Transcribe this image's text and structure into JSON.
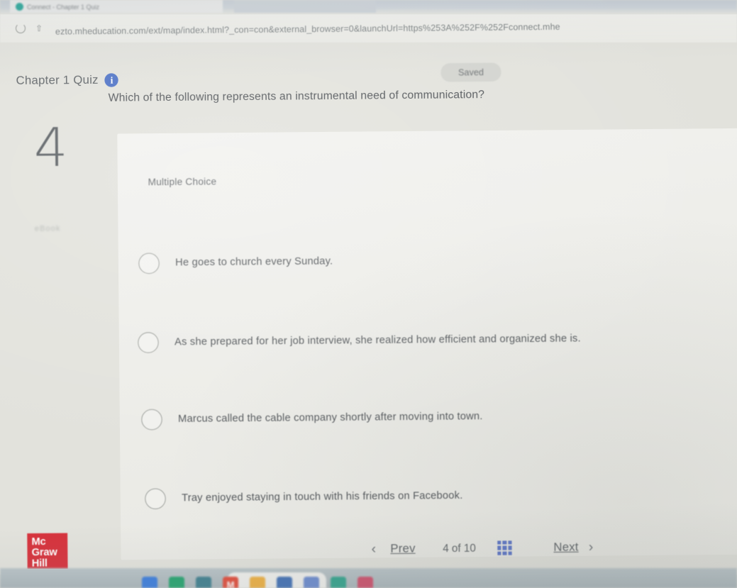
{
  "browser": {
    "tab_title": "Connect - Chapter 1 Quiz",
    "url": "ezto.mheducation.com/ext/map/index.html?_con=con&external_browser=0&launchUrl=https%253A%252F%252Fconnect.mhe",
    "reload_icon": "reload-icon",
    "share_icon": "share-icon"
  },
  "quiz": {
    "title": "Chapter 1 Quiz",
    "info_icon_glyph": "i",
    "saved_label": "Saved",
    "question_number": "4",
    "question_sublabel": "eBook",
    "question_text": "Which of the following represents an instrumental need of communication?",
    "question_type_label": "Multiple Choice",
    "choices": [
      {
        "label": "He goes to church every Sunday.",
        "selected": false
      },
      {
        "label": "As she prepared for her job interview, she realized how efficient and organized she is.",
        "selected": false
      },
      {
        "label": "Marcus called the cable company shortly after moving into town.",
        "selected": false
      },
      {
        "label": "Tray enjoyed staying in touch with his friends on Facebook.",
        "selected": false
      }
    ]
  },
  "footer": {
    "logo_line1": "Mc",
    "logo_line2": "Graw",
    "logo_line3": "Hill",
    "logo_color": "#d6323c",
    "prev_chevron": "‹",
    "prev_label": "Prev",
    "page_counter": "4 of 10",
    "grid_icon": "grid-view-icon",
    "next_label": "Next",
    "next_chevron": "›"
  },
  "taskbar": {
    "icons": [
      {
        "name": "chrome-icon",
        "glyph": "",
        "color": "#3b7ddd"
      },
      {
        "name": "drive-icon",
        "glyph": "",
        "color": "#25a36f"
      },
      {
        "name": "briefcase-icon",
        "glyph": "",
        "color": "#3e7f8f"
      },
      {
        "name": "gmail-icon",
        "glyph": "M",
        "color": "#e24b3a"
      },
      {
        "name": "folder-icon",
        "glyph": "",
        "color": "#efb040"
      },
      {
        "name": "opera-icon",
        "glyph": "",
        "color": "#3f6fb5"
      },
      {
        "name": "store-icon",
        "glyph": "",
        "color": "#6a8ad0"
      },
      {
        "name": "camera-icon",
        "glyph": "",
        "color": "#2fa38c"
      },
      {
        "name": "music-icon",
        "glyph": "",
        "color": "#cf4d6a"
      }
    ],
    "search_placeholder": ""
  },
  "colors": {
    "accent_blue": "#4a6fc4",
    "brand_red": "#d6323c",
    "page_bg": "#e2e2dc",
    "text": "#54585c"
  }
}
